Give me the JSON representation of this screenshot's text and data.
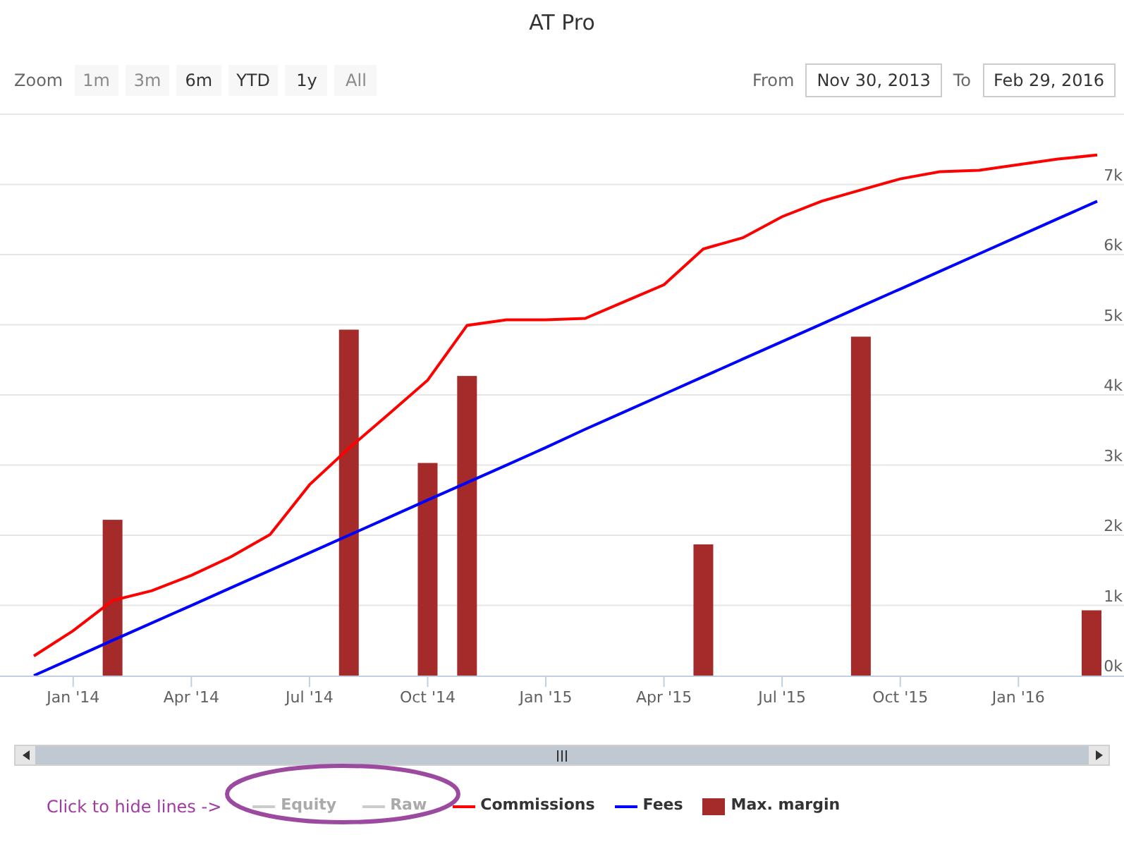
{
  "title": "AT Pro",
  "range_selector": {
    "zoom_label": "Zoom",
    "buttons": [
      {
        "label": "1m",
        "disabled": true
      },
      {
        "label": "3m",
        "disabled": true
      },
      {
        "label": "6m",
        "disabled": false
      },
      {
        "label": "YTD",
        "disabled": false
      },
      {
        "label": "1y",
        "disabled": false
      },
      {
        "label": "All",
        "disabled": true
      }
    ],
    "from_label": "From",
    "from_value": "Nov 30, 2013",
    "to_label": "To",
    "to_value": "Feb 29, 2016"
  },
  "chart": {
    "chart_data": {
      "type": "line",
      "grid": true,
      "ylim": [
        0,
        8000
      ],
      "categories": [
        null,
        "Jan '14",
        null,
        null,
        "Apr '14",
        null,
        null,
        "Jul '14",
        null,
        null,
        "Oct '14",
        null,
        null,
        "Jan '15",
        null,
        null,
        "Apr '15",
        null,
        null,
        "Jul '15",
        null,
        null,
        "Oct '15",
        null,
        null,
        "Jan '16",
        null,
        null
      ],
      "yticks": [
        {
          "value": 0,
          "label": "0k"
        },
        {
          "value": 1000,
          "label": "1k"
        },
        {
          "value": 2000,
          "label": "2k"
        },
        {
          "value": 3000,
          "label": "3k"
        },
        {
          "value": 4000,
          "label": "4k"
        },
        {
          "value": 5000,
          "label": "5k"
        },
        {
          "value": 6000,
          "label": "6k"
        },
        {
          "value": 7000,
          "label": "7k"
        }
      ],
      "series": [
        {
          "name": "Commissions",
          "color": "#ff0000",
          "values": [
            280,
            640,
            1070,
            1210,
            1430,
            1690,
            2010,
            2720,
            3240,
            3720,
            4210,
            4990,
            5070,
            5070,
            5090,
            5330,
            5570,
            6080,
            6240,
            6540,
            6760,
            6920,
            7080,
            7180,
            7200,
            7280,
            7360,
            7420
          ]
        },
        {
          "name": "Fees",
          "color": "#0000ff",
          "values": [
            0,
            250,
            500,
            750,
            1000,
            1250,
            1500,
            1750,
            2000,
            2250,
            2500,
            2750,
            3000,
            3250,
            3510,
            3760,
            4010,
            4260,
            4510,
            4760,
            5010,
            5260,
            5510,
            5760,
            6010,
            6260,
            6510,
            6760
          ]
        },
        {
          "name": "Max. margin",
          "type": "bar",
          "color": "#a52a2a",
          "values": [
            null,
            null,
            2220,
            null,
            null,
            null,
            null,
            null,
            4930,
            null,
            3030,
            4270,
            null,
            null,
            null,
            null,
            null,
            1870,
            null,
            null,
            null,
            4830,
            null,
            null,
            null,
            null,
            null,
            930
          ]
        }
      ]
    }
  },
  "legend": {
    "note": "Click to hide lines ->",
    "items": [
      {
        "name": "Equity",
        "kind": "line",
        "color": "#cccccc",
        "visible": false
      },
      {
        "name": "Raw",
        "kind": "line",
        "color": "#cccccc",
        "visible": false
      }
    ]
  }
}
